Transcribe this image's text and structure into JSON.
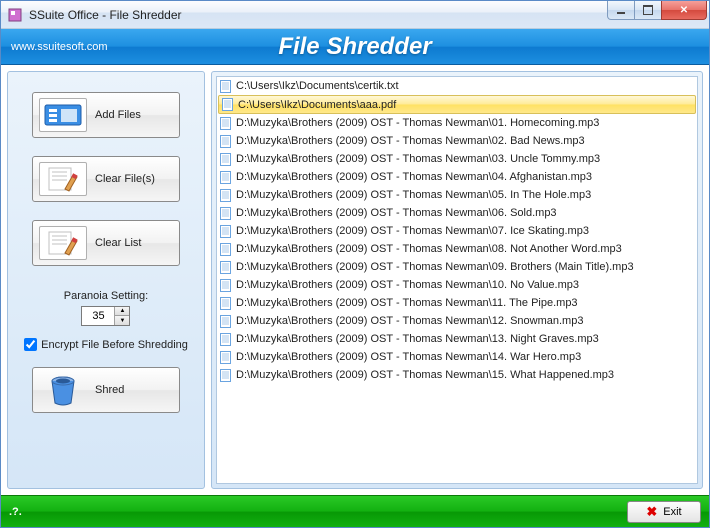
{
  "window": {
    "title": "SSuite Office - File Shredder"
  },
  "header": {
    "url": "www.ssuitesoft.com",
    "app_title": "File Shredder"
  },
  "sidebar": {
    "add_files_label": "Add Files",
    "clear_files_label": "Clear File(s)",
    "clear_list_label": "Clear List",
    "paranoia_label": "Paranoia Setting:",
    "paranoia_value": "35",
    "encrypt_label": "Encrypt File Before Shredding",
    "encrypt_checked": true,
    "shred_label": "Shred"
  },
  "footer": {
    "help_text": ".?.",
    "exit_label": "Exit"
  },
  "file_list": {
    "selected_index": 1,
    "items": [
      "C:\\Users\\Ikz\\Documents\\certik.txt",
      "C:\\Users\\Ikz\\Documents\\aaa.pdf",
      "D:\\Muzyka\\Brothers (2009) OST - Thomas Newman\\01. Homecoming.mp3",
      "D:\\Muzyka\\Brothers (2009) OST - Thomas Newman\\02. Bad News.mp3",
      "D:\\Muzyka\\Brothers (2009) OST - Thomas Newman\\03. Uncle Tommy.mp3",
      "D:\\Muzyka\\Brothers (2009) OST - Thomas Newman\\04. Afghanistan.mp3",
      "D:\\Muzyka\\Brothers (2009) OST - Thomas Newman\\05. In The Hole.mp3",
      "D:\\Muzyka\\Brothers (2009) OST - Thomas Newman\\06. Sold.mp3",
      "D:\\Muzyka\\Brothers (2009) OST - Thomas Newman\\07. Ice Skating.mp3",
      "D:\\Muzyka\\Brothers (2009) OST - Thomas Newman\\08. Not Another Word.mp3",
      "D:\\Muzyka\\Brothers (2009) OST - Thomas Newman\\09. Brothers (Main Title).mp3",
      "D:\\Muzyka\\Brothers (2009) OST - Thomas Newman\\10. No Value.mp3",
      "D:\\Muzyka\\Brothers (2009) OST - Thomas Newman\\11. The Pipe.mp3",
      "D:\\Muzyka\\Brothers (2009) OST - Thomas Newman\\12. Snowman.mp3",
      "D:\\Muzyka\\Brothers (2009) OST - Thomas Newman\\13. Night Graves.mp3",
      "D:\\Muzyka\\Brothers (2009) OST - Thomas Newman\\14. War Hero.mp3",
      "D:\\Muzyka\\Brothers (2009) OST - Thomas Newman\\15. What Happened.mp3"
    ]
  }
}
